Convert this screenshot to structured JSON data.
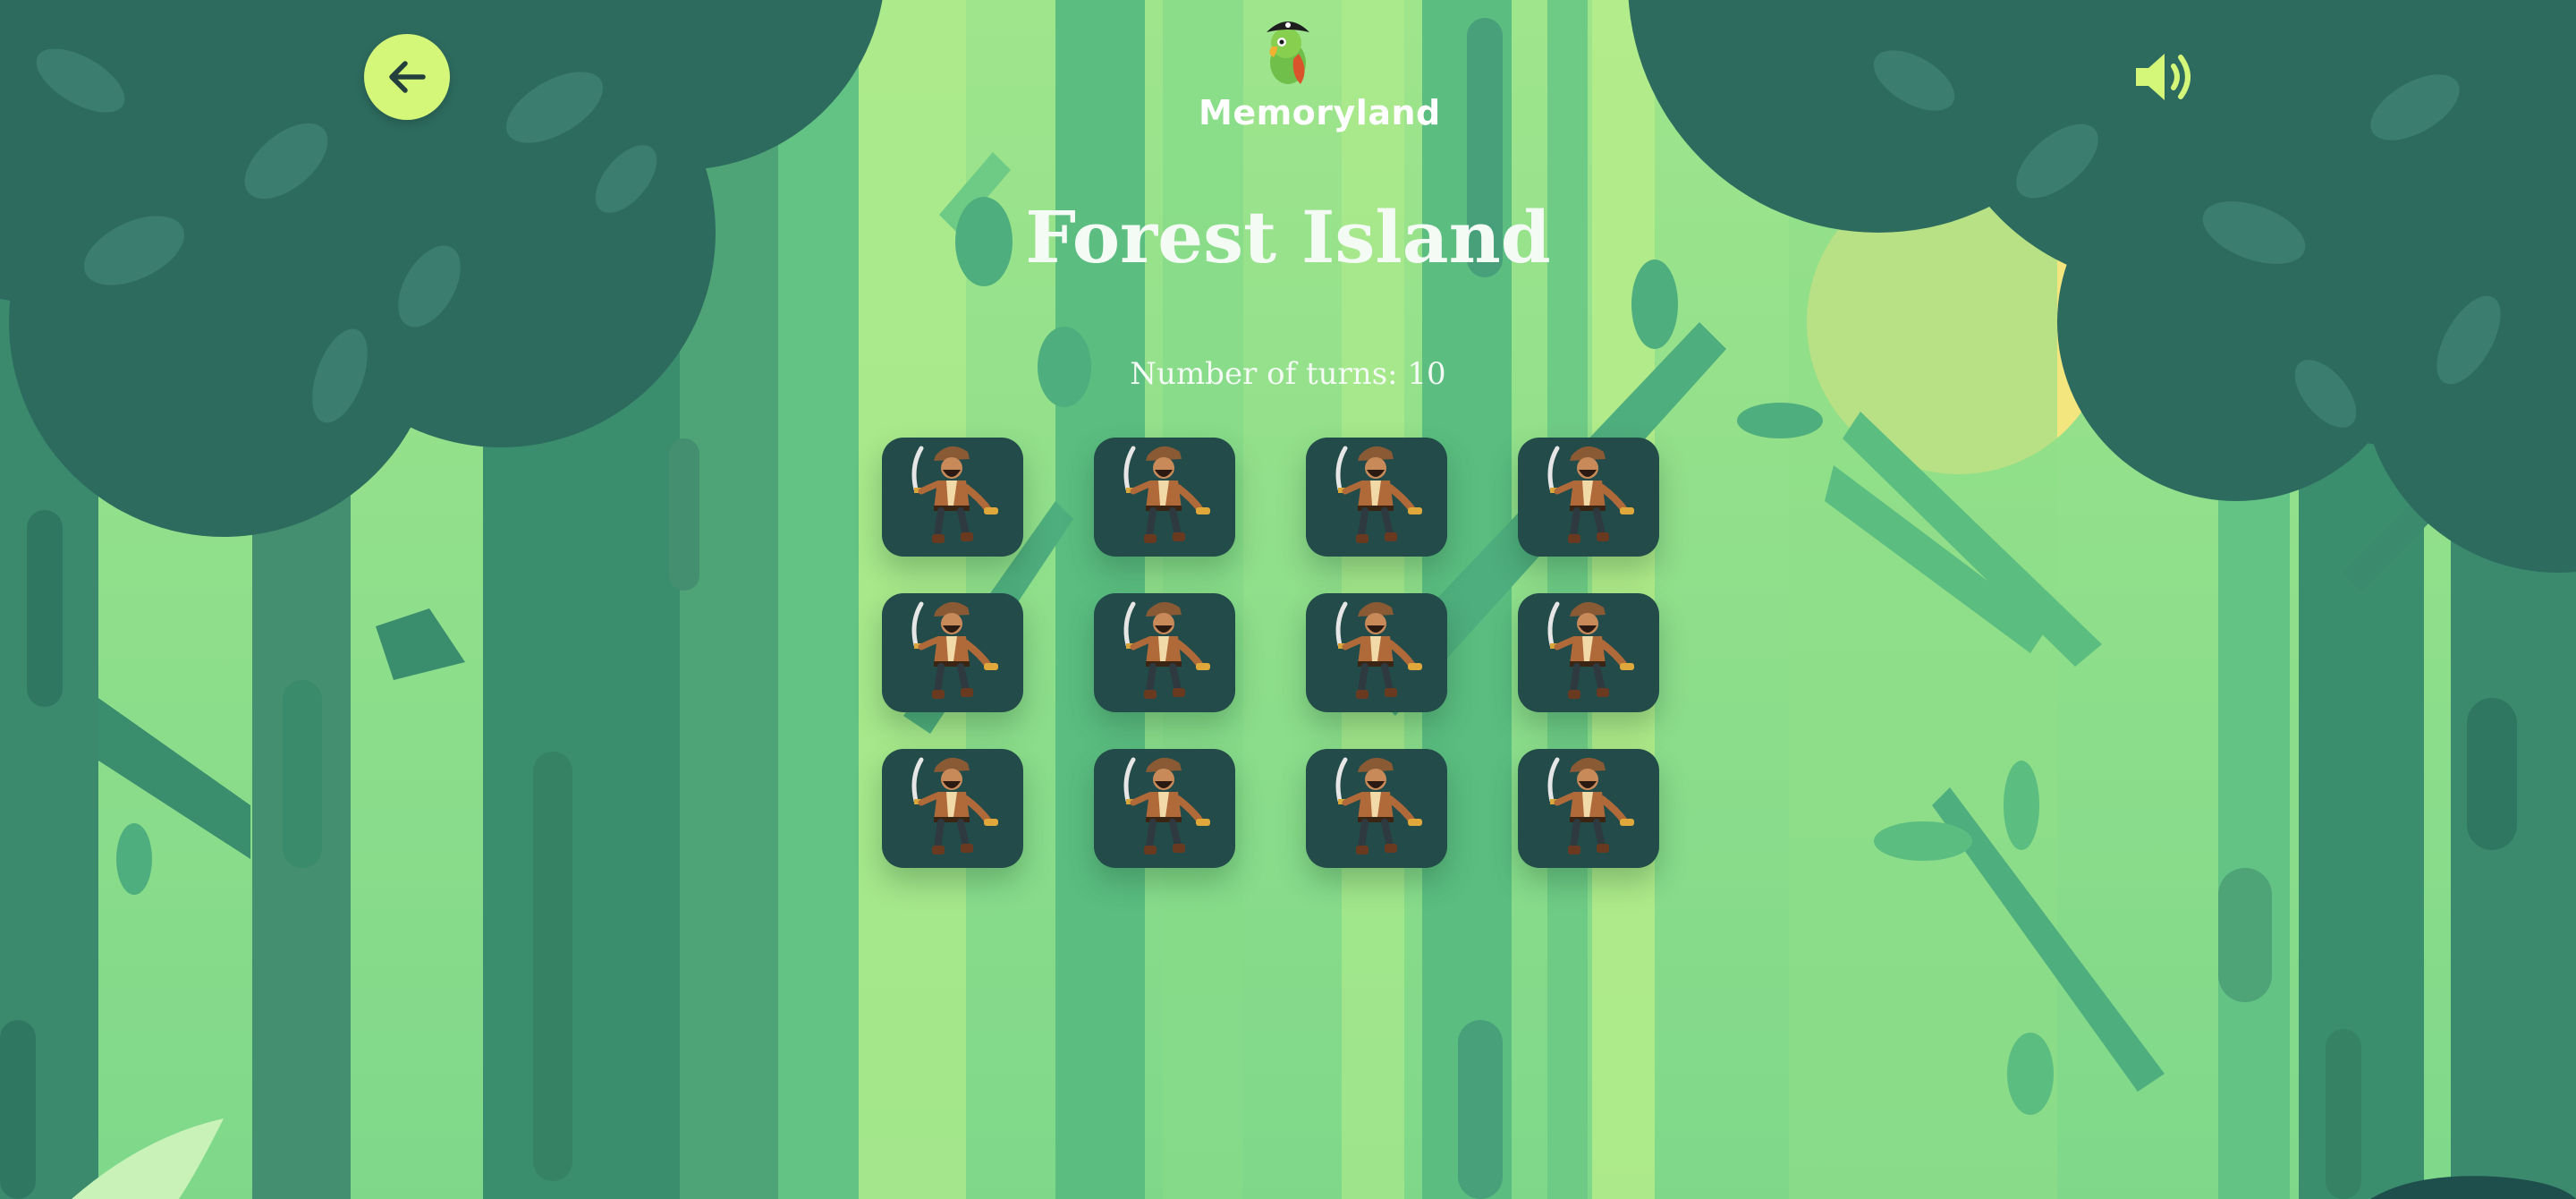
{
  "app": {
    "name": "Memoryland",
    "logo_icon": "parrot-pirate-icon"
  },
  "header": {
    "back_icon": "arrow-left-icon",
    "sound_icon": "speaker-volume-icon"
  },
  "level": {
    "title": "Forest Island",
    "turns_text": "Number of turns: 10"
  },
  "board": {
    "rows": 3,
    "columns": 4,
    "cards": [
      {
        "state": "face-down",
        "icon": "pirate-icon"
      },
      {
        "state": "face-down",
        "icon": "pirate-icon"
      },
      {
        "state": "face-down",
        "icon": "pirate-icon"
      },
      {
        "state": "face-down",
        "icon": "pirate-icon"
      },
      {
        "state": "face-down",
        "icon": "pirate-icon"
      },
      {
        "state": "face-down",
        "icon": "pirate-icon"
      },
      {
        "state": "face-down",
        "icon": "pirate-icon"
      },
      {
        "state": "face-down",
        "icon": "pirate-icon"
      },
      {
        "state": "face-down",
        "icon": "pirate-icon"
      },
      {
        "state": "face-down",
        "icon": "pirate-icon"
      },
      {
        "state": "face-down",
        "icon": "pirate-icon"
      },
      {
        "state": "face-down",
        "icon": "pirate-icon"
      }
    ]
  },
  "colors": {
    "accent": "#d4f77a",
    "card_back": "#234b49",
    "canopy": "#2d6b5e",
    "sky_light": "#a9e98a",
    "sun": "#f6e77e"
  }
}
